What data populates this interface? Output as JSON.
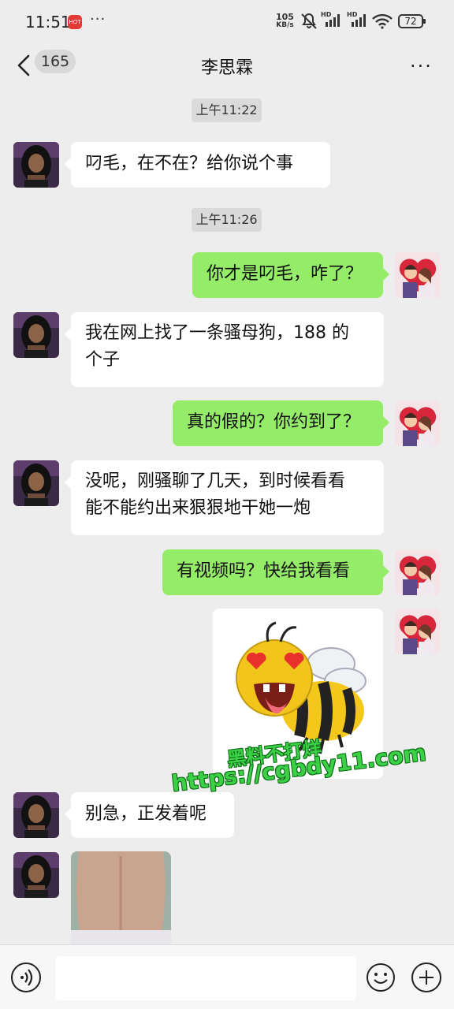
{
  "status_bar": {
    "time": "11:51",
    "app_badge": "HOT",
    "more": "···",
    "net_speed_value": "105",
    "net_speed_unit": "KB/s",
    "sim_label": "HD",
    "battery": "72",
    "icons": [
      "app-badge-icon",
      "mute-icon",
      "signal-icon",
      "signal-icon",
      "wifi-icon",
      "battery-icon"
    ]
  },
  "header": {
    "unread_count": "165",
    "title": "李思霖",
    "more": "···"
  },
  "messages": [
    {
      "type": "time",
      "text": "上午11:22"
    },
    {
      "type": "text",
      "side": "left",
      "text": "叼毛，在不在？给你说个事"
    },
    {
      "type": "time",
      "text": "上午11:26"
    },
    {
      "type": "text",
      "side": "right",
      "text": "你才是叼毛，咋了？"
    },
    {
      "type": "text",
      "side": "left",
      "lines": [
        "我在网上找了一条骚母狗，188 的",
        "个子"
      ]
    },
    {
      "type": "text",
      "side": "right",
      "text": "真的假的？你约到了？"
    },
    {
      "type": "text",
      "side": "left",
      "lines": [
        "没呢，刚骚聊了几天，到时候看看",
        "能不能约出来狠狠地干她一炮"
      ]
    },
    {
      "type": "text",
      "side": "right",
      "text": "有视频吗？快给我看看"
    },
    {
      "type": "sticker",
      "side": "right",
      "icon": "bee-sticker-icon"
    },
    {
      "type": "text",
      "side": "left",
      "text": "别急，正发着呢"
    },
    {
      "type": "image",
      "side": "left",
      "icon": "photo-thumbnail"
    }
  ],
  "watermark": {
    "line1": "黑料不打烊",
    "line2": "https://cgbdy11.com"
  },
  "input_bar": {
    "placeholder": "",
    "icons": [
      "voice-icon",
      "emoji-icon",
      "plus-icon"
    ]
  },
  "colors": {
    "background": "#ededed",
    "bubble_self": "#95ec69",
    "bubble_other": "#ffffff",
    "watermark": "#3cd046"
  }
}
